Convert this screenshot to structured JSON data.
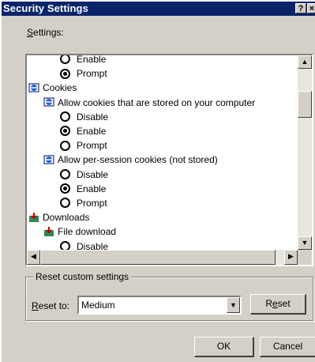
{
  "title": "Security Settings",
  "title_buttons": {
    "help": "?",
    "close": "×"
  },
  "settings_label": {
    "mnemonic": "S",
    "rest": "ettings:"
  },
  "tree": [
    {
      "kind": "radio",
      "label": "Enable",
      "checked": false
    },
    {
      "kind": "radio",
      "label": "Prompt",
      "checked": true
    },
    {
      "kind": "category",
      "label": "Cookies",
      "icon": "settings-category-icon"
    },
    {
      "kind": "setting",
      "label": "Allow cookies that are stored on your computer",
      "icon": "setting-item-icon"
    },
    {
      "kind": "radio",
      "label": "Disable",
      "checked": false
    },
    {
      "kind": "radio",
      "label": "Enable",
      "checked": true
    },
    {
      "kind": "radio",
      "label": "Prompt",
      "checked": false
    },
    {
      "kind": "setting",
      "label": "Allow per-session cookies (not stored)",
      "icon": "setting-item-icon"
    },
    {
      "kind": "radio",
      "label": "Disable",
      "checked": false
    },
    {
      "kind": "radio",
      "label": "Enable",
      "checked": true
    },
    {
      "kind": "radio",
      "label": "Prompt",
      "checked": false
    },
    {
      "kind": "category",
      "label": "Downloads",
      "icon": "download-category-icon"
    },
    {
      "kind": "setting",
      "label": "File download",
      "icon": "download-item-icon"
    },
    {
      "kind": "radio",
      "label": "Disable",
      "checked": false
    }
  ],
  "reset_group": {
    "legend": "Reset custom settings",
    "reset_to_label": {
      "mnemonic": "R",
      "rest": "eset to:"
    },
    "level": "Medium",
    "reset_button": {
      "pre": "R",
      "mnemonic": "e",
      "post": "set"
    }
  },
  "buttons": {
    "ok": "OK",
    "cancel": "Cancel"
  },
  "colors": {
    "titlebar": "#0a246a",
    "face": "#d4d0c8"
  }
}
